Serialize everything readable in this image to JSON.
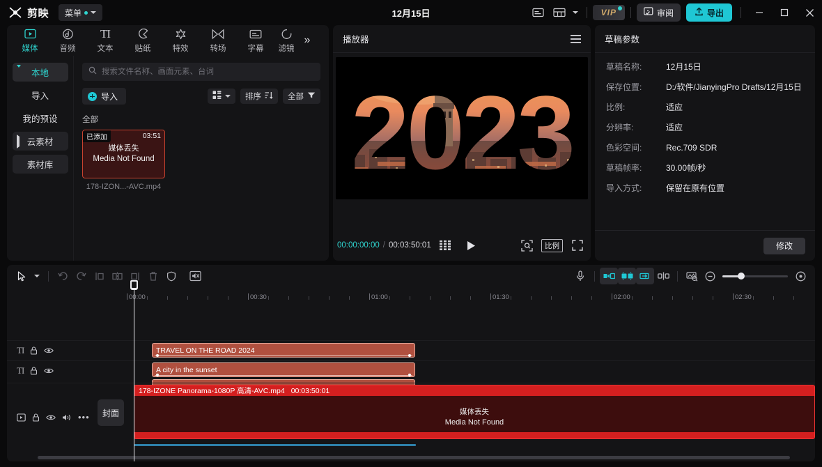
{
  "titlebar": {
    "app_name": "剪映",
    "menu_label": "菜单",
    "project_title": "12月15日",
    "vip_label": "VIP",
    "review_label": "审阅",
    "export_label": "导出",
    "icons": {
      "captions": "captions-icon",
      "layout": "layout-icon",
      "minimize": "minimize-icon",
      "maximize": "maximize-icon",
      "close": "close-icon"
    }
  },
  "left_panel": {
    "tabs": [
      {
        "label": "媒体",
        "icon": "media-icon",
        "active": true
      },
      {
        "label": "音频",
        "icon": "audio-icon",
        "active": false
      },
      {
        "label": "文本",
        "icon": "text-icon",
        "active": false
      },
      {
        "label": "贴纸",
        "icon": "sticker-icon",
        "active": false
      },
      {
        "label": "特效",
        "icon": "effects-icon",
        "active": false
      },
      {
        "label": "转场",
        "icon": "transition-icon",
        "active": false
      },
      {
        "label": "字幕",
        "icon": "subtitle-icon",
        "active": false
      },
      {
        "label": "滤镜",
        "icon": "filter-icon",
        "active": false
      }
    ],
    "more_label": "»",
    "categories": [
      {
        "label": "本地",
        "selected": true,
        "expandable": true,
        "expanded": true
      },
      {
        "label": "导入",
        "selected": false,
        "expandable": false,
        "expanded": false
      },
      {
        "label": "我的预设",
        "selected": false,
        "expandable": false,
        "expanded": false
      },
      {
        "label": "云素材",
        "selected": false,
        "expandable": true,
        "expanded": false
      },
      {
        "label": "素材库",
        "selected": false,
        "expandable": false,
        "expanded": false
      }
    ],
    "search": {
      "placeholder": "搜索文件名称、画面元素、台词",
      "value": ""
    },
    "import_label": "导入",
    "sort_label": "排序",
    "filter_label": "全部",
    "section_label": "全部",
    "media_items": [
      {
        "badge": "已添加",
        "duration": "03:51",
        "error_cn": "媒体丢失",
        "error_en": "Media Not Found",
        "name": "178-IZON...-AVC.mp4"
      }
    ]
  },
  "player": {
    "title": "播放器",
    "preview_text": "2023",
    "current_time": "00:00:00:00",
    "total_time": "00:03:50:01",
    "ratio_label": "比例",
    "icons": {
      "frames": "frames-icon",
      "play": "play-icon",
      "crop": "crop-icon",
      "fullscreen": "fullscreen-icon",
      "menu": "hamburger-icon"
    }
  },
  "draft_params": {
    "title": "草稿参数",
    "rows": [
      {
        "key": "草稿名称:",
        "value": "12月15日"
      },
      {
        "key": "保存位置:",
        "value": "D:/软件/JianyingPro Drafts/12月15日"
      },
      {
        "key": "比例:",
        "value": "适应"
      },
      {
        "key": "分辨率:",
        "value": "适应"
      },
      {
        "key": "色彩空间:",
        "value": "Rec.709 SDR"
      },
      {
        "key": "草稿帧率:",
        "value": "30.00帧/秒"
      },
      {
        "key": "导入方式:",
        "value": "保留在原有位置"
      }
    ],
    "modify_label": "修改"
  },
  "timeline": {
    "toolbar_icons": [
      "select-cursor-icon",
      "chevron-down-icon",
      "undo-icon",
      "redo-icon",
      "split-left-icon",
      "split-icon",
      "split-right-icon",
      "delete-icon",
      "shield-icon",
      "mute-clip-icon",
      "microphone-icon",
      "snap-left-icon",
      "auto-snap-icon",
      "snap-right-icon",
      "split-marker-icon",
      "keyframe-icon",
      "zoom-out-icon",
      "zoom-in-icon"
    ],
    "ruler_labels": [
      "00:00",
      "00:30",
      "01:00",
      "01:30",
      "02:00",
      "02:30"
    ],
    "text_tracks": [
      {
        "icon": "text-track-icon",
        "lock": "lock-icon",
        "eye": "eye-icon",
        "clip_label": "TRAVEL ON THE ROAD 2024"
      },
      {
        "icon": "text-track-icon",
        "lock": "lock-icon",
        "eye": "eye-icon",
        "clip_label": "A city in the sunset"
      }
    ],
    "video_track": {
      "cover_label": "封面",
      "clip_name": "178-IZONE Panorama-1080P 高清-AVC.mp4",
      "clip_duration": "00:03:50:01",
      "error_cn": "媒体丢失",
      "error_en": "Media Not Found",
      "head_icons": [
        "video-track-icon",
        "lock-icon",
        "eye-icon",
        "volume-icon",
        "more-icon"
      ]
    },
    "playhead_time": "00:00:00:00"
  },
  "colors": {
    "accent": "#1fc7d4",
    "accent_text": "#2fd4cf",
    "panel_bg": "#141416",
    "app_bg": "#0a0a0b",
    "clip_text_bg": "#b0503f",
    "clip_video_bar": "#d41f1f",
    "clip_video_body": "#3d0d0d",
    "audio_wave": "#2d7fa8",
    "vip_gold": "#cfa96a"
  }
}
